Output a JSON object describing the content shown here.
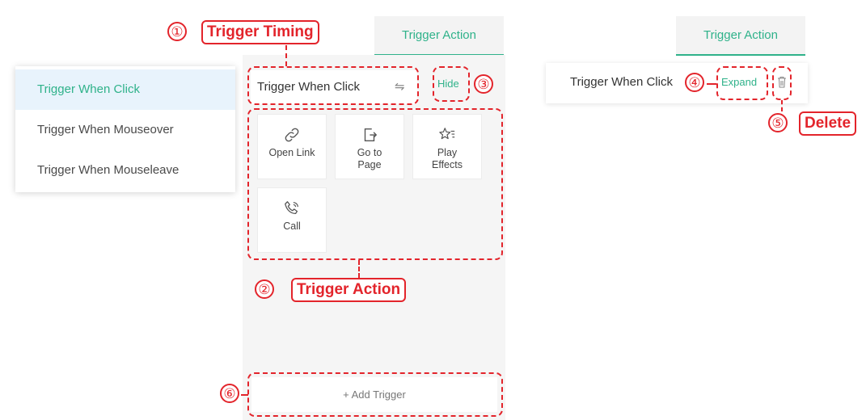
{
  "timing_menu": {
    "items": [
      {
        "label": "Trigger When Click",
        "selected": true
      },
      {
        "label": "Trigger When Mouseover",
        "selected": false
      },
      {
        "label": "Trigger When Mouseleave",
        "selected": false
      }
    ]
  },
  "left_panel": {
    "tab": "Trigger Action",
    "timing_value": "Trigger When Click",
    "hide_label": "Hide",
    "actions": [
      {
        "label": "Open Link",
        "icon": "link-icon"
      },
      {
        "label": "Go to Page",
        "icon": "go-to-page-icon"
      },
      {
        "label": "Play Effects",
        "icon": "star-effects-icon"
      },
      {
        "label": "Call",
        "icon": "phone-icon"
      }
    ],
    "add_trigger_label": "+ Add Trigger"
  },
  "right_panel": {
    "tab": "Trigger Action",
    "row_text": "Trigger When Click",
    "expand_label": "Expand",
    "delete_icon": "trash-icon"
  },
  "annotations": {
    "callouts": [
      {
        "num": "①",
        "label": "Trigger Timing"
      },
      {
        "num": "②",
        "label": "Trigger Action"
      },
      {
        "num": "③",
        "label": ""
      },
      {
        "num": "④",
        "label": ""
      },
      {
        "num": "⑤",
        "label": "Delete"
      },
      {
        "num": "⑥",
        "label": ""
      }
    ]
  },
  "colors": {
    "accent": "#2fb28a",
    "annotation": "#e3242b",
    "selected_bg": "#e8f3fc"
  }
}
